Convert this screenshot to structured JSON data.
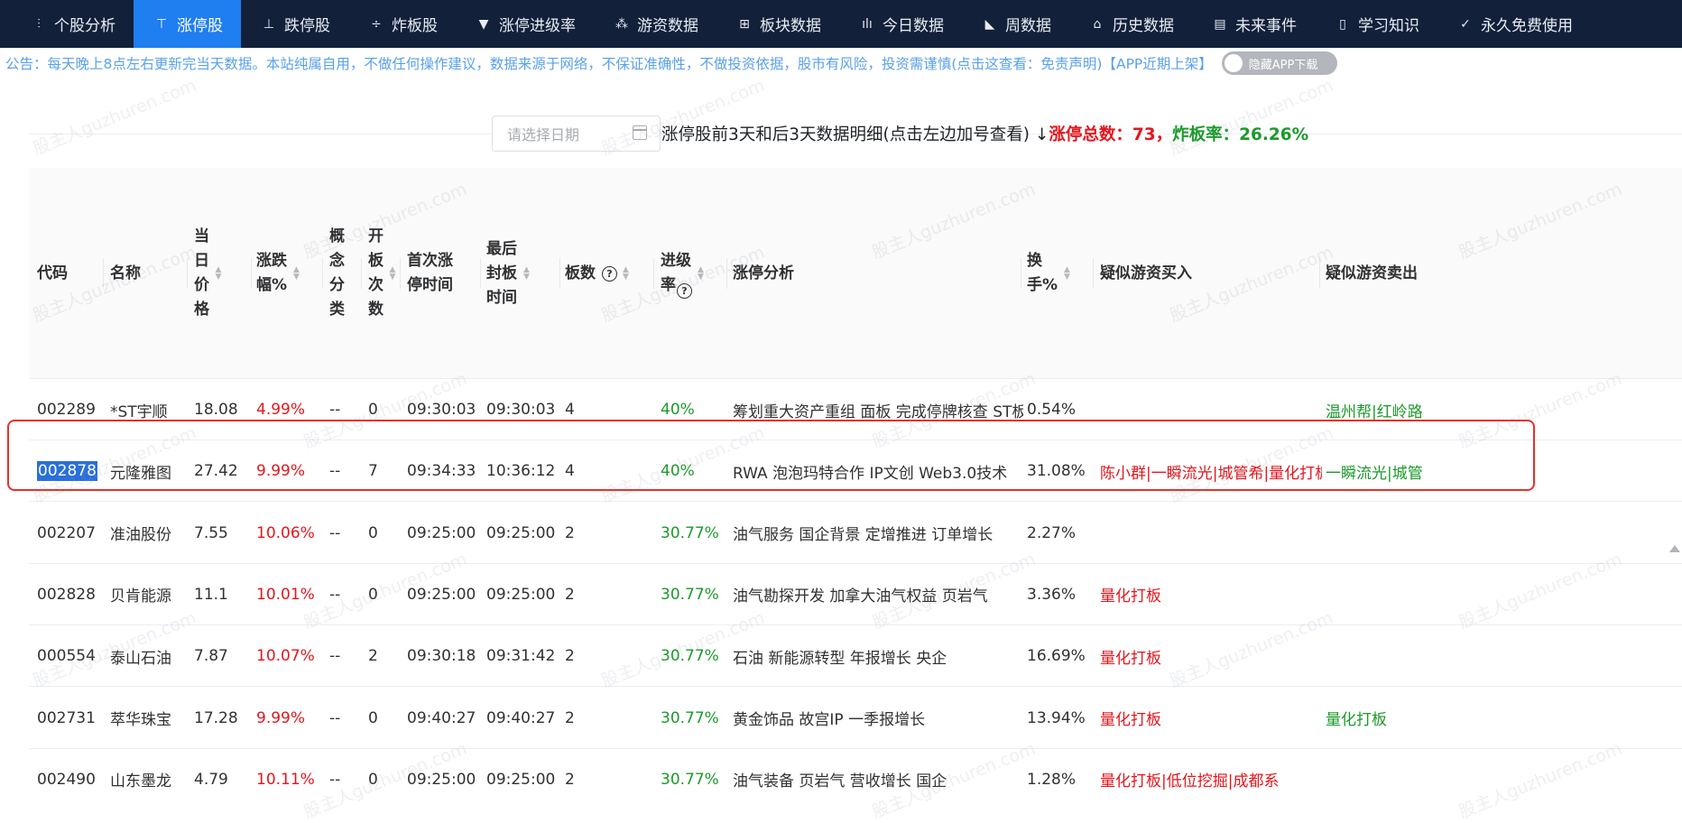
{
  "nav": {
    "items": [
      {
        "label": "个股分析",
        "icon": "sliders-icon",
        "glyph": "⫶",
        "active": false
      },
      {
        "label": "涨停股",
        "icon": "filter-icon",
        "glyph": "⊤",
        "active": true
      },
      {
        "label": "跌停股",
        "icon": "down-line-icon",
        "glyph": "⊥",
        "active": false
      },
      {
        "label": "炸板股",
        "icon": "split-icon",
        "glyph": "÷",
        "active": false
      },
      {
        "label": "涨停进级率",
        "icon": "caret-down-icon",
        "glyph": "▼",
        "active": false
      },
      {
        "label": "游资数据",
        "icon": "network-icon",
        "glyph": "⁂",
        "active": false
      },
      {
        "label": "板块数据",
        "icon": "grid-icon",
        "glyph": "⊞",
        "active": false
      },
      {
        "label": "今日数据",
        "icon": "bar-chart-icon",
        "glyph": "ılı",
        "active": false
      },
      {
        "label": "周数据",
        "icon": "area-chart-icon",
        "glyph": "◣",
        "active": false
      },
      {
        "label": "历史数据",
        "icon": "bank-icon",
        "glyph": "⌂",
        "active": false
      },
      {
        "label": "未来事件",
        "icon": "document-icon",
        "glyph": "▤",
        "active": false
      },
      {
        "label": "学习知识",
        "icon": "book-icon",
        "glyph": "▯",
        "active": false
      },
      {
        "label": "永久免费使用",
        "icon": "check-icon",
        "glyph": "✓",
        "active": false
      }
    ]
  },
  "notice": {
    "text": "公告：每天晚上8点左右更新完当天数据。本站纯属自用，不做任何操作建议，数据来源于网络，不保证准确性，不做投资依据，股市有风险，投资需谨慎(点击这查看：免责声明)【APP近期上架】",
    "toggle_label": "隐藏APP下载"
  },
  "date_picker": {
    "placeholder": "请选择日期"
  },
  "title": {
    "main": "涨停股前3天和后3天数据明细(点击左边加号查看) ↓",
    "red": "涨停总数：73，",
    "green": "炸板率：26.26%"
  },
  "watermark": "股主人guzhuren.com",
  "table": {
    "columns": [
      {
        "key": "code",
        "label": "代码",
        "sortable": false
      },
      {
        "key": "name",
        "label": "名称",
        "sortable": false
      },
      {
        "key": "price",
        "label": "当日价格",
        "sortable": true
      },
      {
        "key": "change",
        "label": "涨跌幅%",
        "sortable": true
      },
      {
        "key": "concept",
        "label": "概念分类",
        "sortable": false
      },
      {
        "key": "open_count",
        "label": "开板次数",
        "sortable": true
      },
      {
        "key": "first_time",
        "label": "首次涨停时间",
        "sortable": false
      },
      {
        "key": "last_time",
        "label": "最后封板时间",
        "sortable": true
      },
      {
        "key": "boards",
        "label": "板数",
        "sortable": true,
        "help": "?"
      },
      {
        "key": "rate",
        "label": "进级率",
        "sortable": true,
        "help": "?"
      },
      {
        "key": "analysis",
        "label": "涨停分析",
        "sortable": false
      },
      {
        "key": "turnover",
        "label": "换手%",
        "sortable": true
      },
      {
        "key": "buy",
        "label": "疑似游资买入",
        "sortable": false
      },
      {
        "key": "sell",
        "label": "疑似游资卖出",
        "sortable": false
      }
    ],
    "rows": [
      {
        "code": "002289",
        "name": "*ST宇顺",
        "price": "18.08",
        "change": "4.99%",
        "concept": "--",
        "open_count": "0",
        "first_time": "09:30:03",
        "last_time": "09:30:03",
        "boards": "4",
        "rate": "40%",
        "analysis": "筹划重大资产重组 面板 完成停牌核查 ST板块",
        "turnover": "0.54%",
        "buy": "",
        "sell": "温州帮|红岭路"
      },
      {
        "code": "002878",
        "name": "元隆雅图",
        "price": "27.42",
        "change": "9.99%",
        "concept": "--",
        "open_count": "7",
        "first_time": "09:34:33",
        "last_time": "10:36:12",
        "boards": "4",
        "rate": "40%",
        "analysis": "RWA 泡泡玛特合作 IP文创 Web3.0技术",
        "turnover": "31.08%",
        "buy": "陈小群|一瞬流光|城管希|量化打板",
        "sell": "一瞬流光|城管"
      },
      {
        "code": "002207",
        "name": "准油股份",
        "price": "7.55",
        "change": "10.06%",
        "concept": "--",
        "open_count": "0",
        "first_time": "09:25:00",
        "last_time": "09:25:00",
        "boards": "2",
        "rate": "30.77%",
        "analysis": "油气服务 国企背景 定增推进 订单增长",
        "turnover": "2.27%",
        "buy": "",
        "sell": ""
      },
      {
        "code": "002828",
        "name": "贝肯能源",
        "price": "11.1",
        "change": "10.01%",
        "concept": "--",
        "open_count": "0",
        "first_time": "09:25:00",
        "last_time": "09:25:00",
        "boards": "2",
        "rate": "30.77%",
        "analysis": "油气勘探开发 加拿大油气权益 页岩气",
        "turnover": "3.36%",
        "buy": "量化打板",
        "sell": ""
      },
      {
        "code": "000554",
        "name": "泰山石油",
        "price": "7.87",
        "change": "10.07%",
        "concept": "--",
        "open_count": "2",
        "first_time": "09:30:18",
        "last_time": "09:31:42",
        "boards": "2",
        "rate": "30.77%",
        "analysis": "石油 新能源转型 年报增长 央企",
        "turnover": "16.69%",
        "buy": "量化打板",
        "sell": ""
      },
      {
        "code": "002731",
        "name": "萃华珠宝",
        "price": "17.28",
        "change": "9.99%",
        "concept": "--",
        "open_count": "0",
        "first_time": "09:40:27",
        "last_time": "09:40:27",
        "boards": "2",
        "rate": "30.77%",
        "analysis": "黄金饰品 故宫IP 一季报增长",
        "turnover": "13.94%",
        "buy": "量化打板",
        "sell": "量化打板"
      },
      {
        "code": "002490",
        "name": "山东墨龙",
        "price": "4.79",
        "change": "10.11%",
        "concept": "--",
        "open_count": "0",
        "first_time": "09:25:00",
        "last_time": "09:25:00",
        "boards": "2",
        "rate": "30.77%",
        "analysis": "油气装备 页岩气 营收增长 国企",
        "turnover": "1.28%",
        "buy": "量化打板|低位挖掘|成都系",
        "sell": ""
      }
    ]
  },
  "colors": {
    "nav_bg": "#12203a",
    "nav_active": "#1f7ef0",
    "red": "#e4161c",
    "green": "#1b9a2a",
    "notice": "#5aa1ea"
  }
}
